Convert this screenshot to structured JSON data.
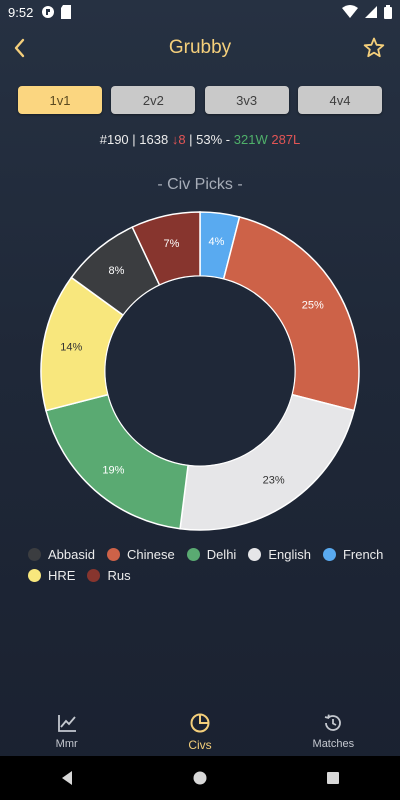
{
  "status_bar": {
    "time": "9:52"
  },
  "app_bar": {
    "title": "Grubby"
  },
  "mode_tabs": [
    {
      "label": "1v1",
      "active": true
    },
    {
      "label": "2v2",
      "active": false
    },
    {
      "label": "3v3",
      "active": false
    },
    {
      "label": "4v4",
      "active": false
    }
  ],
  "stats": {
    "rank": "#190",
    "sep1": " | ",
    "rating": "1638",
    "change_arrow": "↓",
    "change_value": "8",
    "sep2": " | ",
    "win_rate": "53%",
    "sep3": " - ",
    "wins": "321W",
    "losses": "287L"
  },
  "chart_data": {
    "type": "pie",
    "title": "- Civ Picks -",
    "donut": true,
    "slices": [
      {
        "label": "French",
        "value": 4,
        "display": "4%",
        "color": "#59aaf0"
      },
      {
        "label": "Chinese",
        "value": 25,
        "display": "25%",
        "color": "#cd6248"
      },
      {
        "label": "English",
        "value": 23,
        "display": "23%",
        "color": "#e6e6e8"
      },
      {
        "label": "Delhi",
        "value": 19,
        "display": "19%",
        "color": "#5aaa72"
      },
      {
        "label": "HRE",
        "value": 14,
        "display": "14%",
        "color": "#f8e77d"
      },
      {
        "label": "Abbasid",
        "value": 8,
        "display": "8%",
        "color": "#3b3d40"
      },
      {
        "label": "Rus",
        "value": 7,
        "display": "7%",
        "color": "#87352e"
      }
    ],
    "legend": [
      {
        "label": "Abbasid",
        "color": "#3b3d40"
      },
      {
        "label": "Chinese",
        "color": "#cd6248"
      },
      {
        "label": "Delhi",
        "color": "#5aaa72"
      },
      {
        "label": "English",
        "color": "#e6e6e8"
      },
      {
        "label": "French",
        "color": "#59aaf0"
      },
      {
        "label": "HRE",
        "color": "#f8e77d"
      },
      {
        "label": "Rus",
        "color": "#87352e"
      }
    ],
    "legend_position": "bottom-left"
  },
  "bottom_nav": {
    "items": [
      {
        "label": "Mmr",
        "icon": "chart-line-icon",
        "active": false
      },
      {
        "label": "Civs",
        "icon": "pie-chart-icon",
        "active": true
      },
      {
        "label": "Matches",
        "icon": "history-icon",
        "active": false
      }
    ]
  },
  "colors": {
    "accent": "#f4cf7b",
    "background": "#232d3d",
    "win": "#4fb06a",
    "loss": "#e25555"
  }
}
